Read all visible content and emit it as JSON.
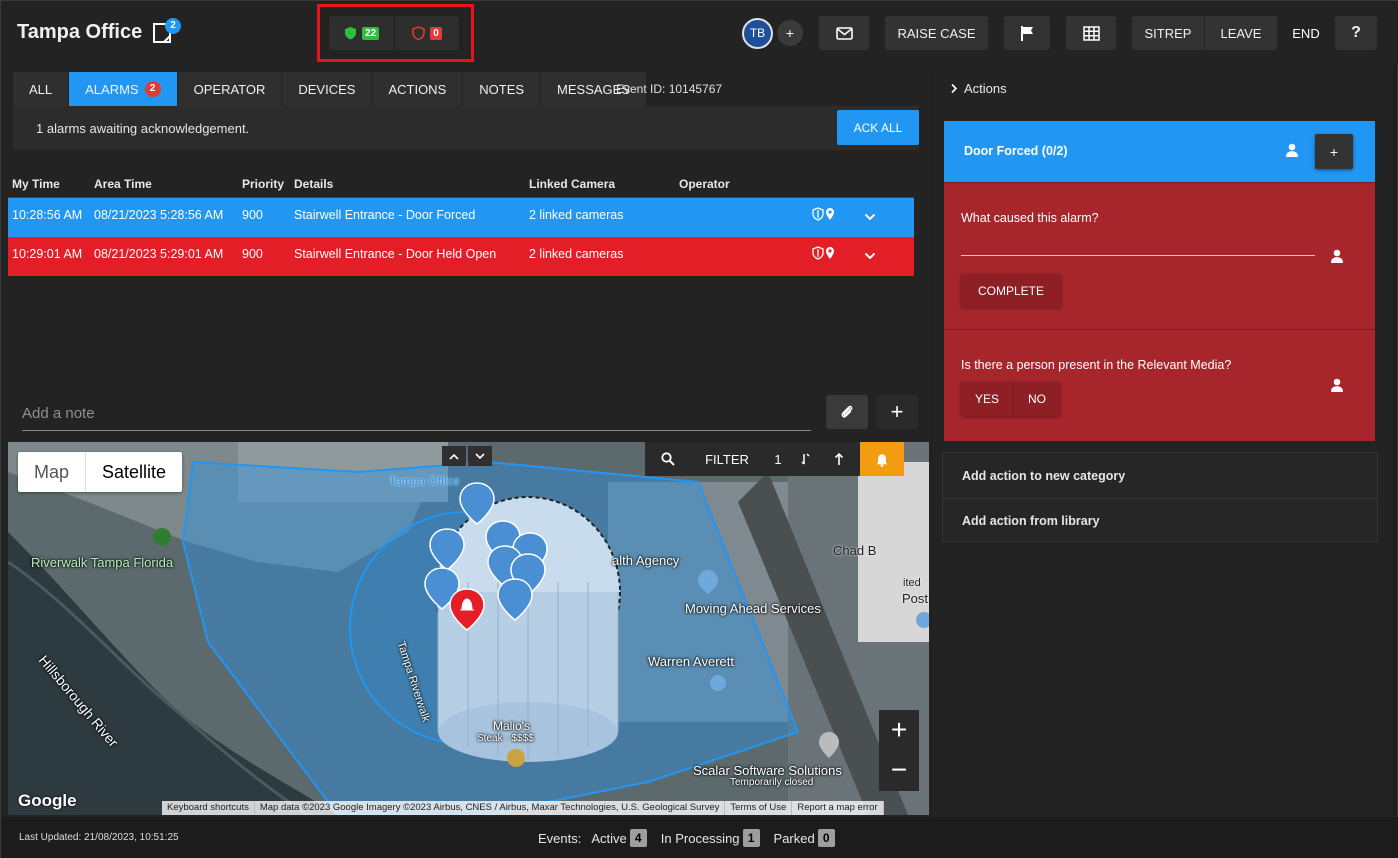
{
  "header": {
    "title": "Tampa Office",
    "notes_badge": "2",
    "good_count": "22",
    "bad_count": "0",
    "avatar_initials": "TB",
    "add_member_label": "+",
    "raise_case_label": "RAISE CASE",
    "sitrep_label": "SITREP",
    "leave_label": "LEAVE",
    "end_label": "END",
    "help_label": "?"
  },
  "tabs": [
    {
      "label": "ALL"
    },
    {
      "label": "ALARMS",
      "badge": "2",
      "active": true
    },
    {
      "label": "OPERATOR"
    },
    {
      "label": "DEVICES"
    },
    {
      "label": "ACTIONS"
    },
    {
      "label": "NOTES"
    },
    {
      "label": "MESSAGES"
    }
  ],
  "event_id": "Event ID: 10145767",
  "ack_bar": {
    "text": "1 alarms awaiting acknowledgement.",
    "button": "ACK ALL"
  },
  "table": {
    "columns": [
      "My Time",
      "Area Time",
      "Priority",
      "Details",
      "Linked Camera",
      "Operator"
    ],
    "rows": [
      {
        "my_time": "10:28:56 AM",
        "area_time": "08/21/2023 5:28:56 AM",
        "priority": "900",
        "details": "Stairwell Entrance - Door Forced",
        "camera": "2 linked cameras",
        "operator": "",
        "color": "#2196f3"
      },
      {
        "my_time": "10:29:01 AM",
        "area_time": "08/21/2023 5:29:01 AM",
        "priority": "900",
        "details": "Stairwell Entrance - Door Held Open",
        "camera": "2 linked cameras",
        "operator": "",
        "color": "#e41e26"
      }
    ]
  },
  "note": {
    "placeholder": "Add a note",
    "add_label": "+"
  },
  "map": {
    "type_map": "Map",
    "type_satellite": "Satellite",
    "filter_label": "FILTER",
    "filter_count": "1",
    "zoom_in": "+",
    "zoom_out": "−",
    "google": "Google",
    "labels": {
      "tampa_office": "Tampa Office",
      "riverwalk": "Riverwalk Tampa Florida",
      "river": "Hillsborough River",
      "health_agency": "alth Agency",
      "moving_ahead": "Moving Ahead Services",
      "warren": "Warren Averett",
      "tampa_riverwalk": "Tampa Riverwalk",
      "malios": "Malio's",
      "steak": "Steak · $$$$",
      "chad": "Chad B",
      "post": "Post",
      "scalar": "Scalar Software Solutions",
      "temp_closed": "Temporarily closed",
      "ited": "ited"
    },
    "attribution": [
      "Keyboard shortcuts",
      "Map data ©2023 Google Imagery ©2023 Airbus, CNES / Airbus, Maxar Technologies, U.S. Geological Survey",
      "Terms of Use",
      "Report a map error"
    ]
  },
  "footer": {
    "last_updated": "Last Updated: 21/08/2023, 10:51:25",
    "events_label": "Events:",
    "active_label": "Active",
    "active_count": "4",
    "processing_label": "In Processing",
    "processing_count": "1",
    "parked_label": "Parked",
    "parked_count": "0"
  },
  "actions_panel": {
    "header": "Actions",
    "card_title": "Door Forced (0/2)",
    "card_add": "+",
    "q1": "What caused this alarm?",
    "complete": "COMPLETE",
    "q2": "Is there a person present in the Relevant Media?",
    "yes": "YES",
    "no": "NO",
    "new_category": "Add action to new category",
    "from_library": "Add action from library"
  },
  "colors": {
    "accent": "#2196f3",
    "alarm_red": "#e41e26",
    "question_bg": "#a6262c",
    "good": "#2fbf3a",
    "bad": "#e53935"
  }
}
